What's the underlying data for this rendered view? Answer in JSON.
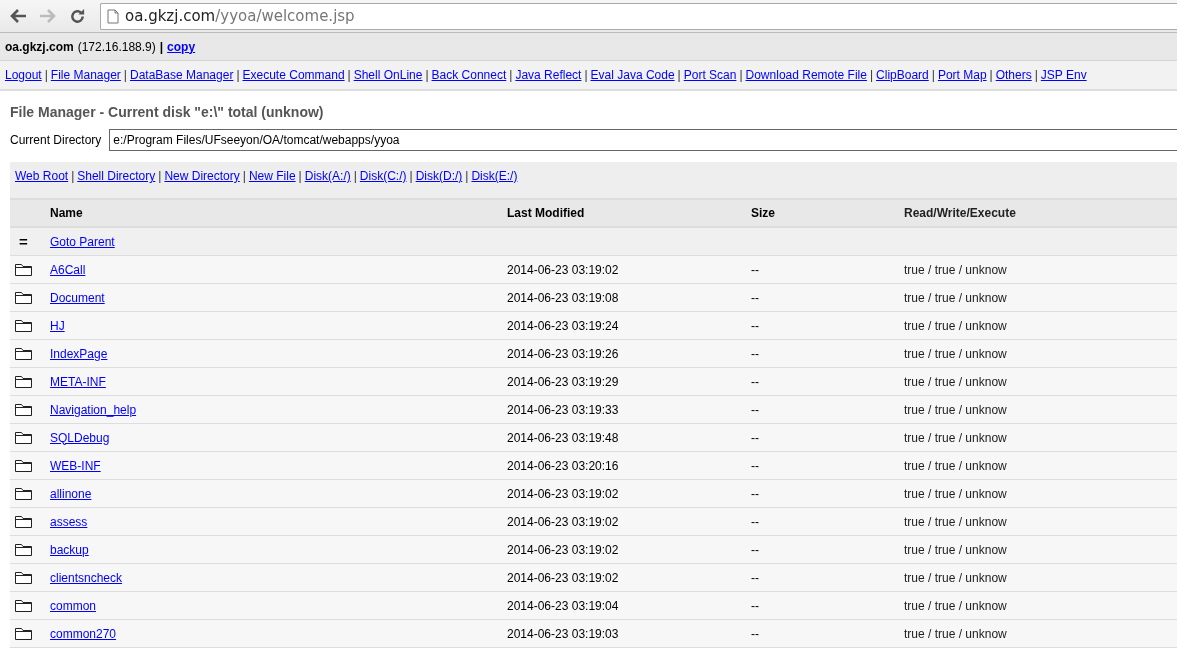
{
  "browser": {
    "back_enabled": true,
    "forward_enabled": false,
    "url_host": "oa.gkzj.com",
    "url_path": "/yyoa/welcome.jsp"
  },
  "info_bar": {
    "host": "oa.gkzj.com",
    "ip": "(172.16.188.9)",
    "separator": "|",
    "copy_link": "copy"
  },
  "nav": {
    "separator": "|",
    "links": [
      "Logout",
      "File Manager",
      "DataBase Manager",
      "Execute Command",
      "Shell OnLine",
      "Back Connect",
      "Java Reflect",
      "Eval Java Code",
      "Port Scan",
      "Download Remote File",
      "ClipBoard",
      "Port Map",
      "Others",
      "JSP Env"
    ]
  },
  "title": "File Manager - Current disk \"e:\\\" total (unknow)",
  "directory": {
    "label": "Current Directory",
    "value": "e:/Program Files/UFseeyon/OA/tomcat/webapps/yyoa"
  },
  "shortcuts": {
    "separator": "|",
    "links": [
      "Web Root",
      "Shell Directory",
      "New Directory",
      "New File",
      "Disk(A:/)",
      "Disk(C:/)",
      "Disk(D:/)",
      "Disk(E:/)"
    ]
  },
  "table": {
    "columns": [
      "Name",
      "Last Modified",
      "Size",
      "Read/Write/Execute"
    ],
    "rows": [
      {
        "kind": "parent",
        "icon_text": "=",
        "name": "Goto Parent"
      },
      {
        "kind": "folder",
        "name": "A6Call",
        "modified": "2014-06-23 03:19:02",
        "size": "--",
        "rwx": "true / true / unknow"
      },
      {
        "kind": "folder",
        "name": "Document",
        "modified": "2014-06-23 03:19:08",
        "size": "--",
        "rwx": "true / true / unknow"
      },
      {
        "kind": "folder",
        "name": "HJ",
        "modified": "2014-06-23 03:19:24",
        "size": "--",
        "rwx": "true / true / unknow"
      },
      {
        "kind": "folder",
        "name": "IndexPage",
        "modified": "2014-06-23 03:19:26",
        "size": "--",
        "rwx": "true / true / unknow"
      },
      {
        "kind": "folder",
        "name": "META-INF",
        "modified": "2014-06-23 03:19:29",
        "size": "--",
        "rwx": "true / true / unknow"
      },
      {
        "kind": "folder",
        "name": "Navigation_help",
        "modified": "2014-06-23 03:19:33",
        "size": "--",
        "rwx": "true / true / unknow"
      },
      {
        "kind": "folder",
        "name": "SQLDebug",
        "modified": "2014-06-23 03:19:48",
        "size": "--",
        "rwx": "true / true / unknow"
      },
      {
        "kind": "folder",
        "name": "WEB-INF",
        "modified": "2014-06-23 03:20:16",
        "size": "--",
        "rwx": "true / true / unknow"
      },
      {
        "kind": "folder",
        "name": "allinone",
        "modified": "2014-06-23 03:19:02",
        "size": "--",
        "rwx": "true / true / unknow"
      },
      {
        "kind": "folder",
        "name": "assess",
        "modified": "2014-06-23 03:19:02",
        "size": "--",
        "rwx": "true / true / unknow"
      },
      {
        "kind": "folder",
        "name": "backup",
        "modified": "2014-06-23 03:19:02",
        "size": "--",
        "rwx": "true / true / unknow"
      },
      {
        "kind": "folder",
        "name": "clientsncheck",
        "modified": "2014-06-23 03:19:02",
        "size": "--",
        "rwx": "true / true / unknow"
      },
      {
        "kind": "folder",
        "name": "common",
        "modified": "2014-06-23 03:19:04",
        "size": "--",
        "rwx": "true / true / unknow"
      },
      {
        "kind": "folder",
        "name": "common270",
        "modified": "2014-06-23 03:19:03",
        "size": "--",
        "rwx": "true / true / unknow"
      }
    ]
  }
}
